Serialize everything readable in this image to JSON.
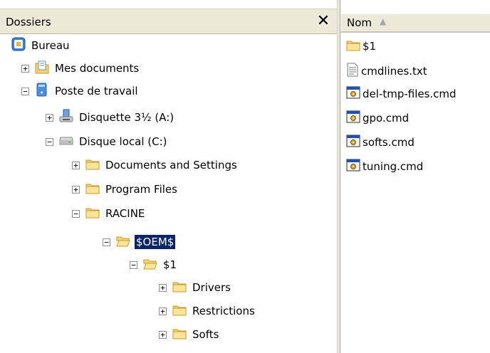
{
  "folders_pane": {
    "title": "Dossiers",
    "close_label": "✕",
    "tree": [
      {
        "label": "Bureau",
        "icon": "desktop-icon",
        "toggle": ""
      },
      {
        "label": "Mes documents",
        "icon": "my-documents-icon",
        "toggle": "+"
      },
      {
        "label": "Poste de travail",
        "icon": "my-computer-icon",
        "toggle": "−"
      },
      {
        "label": "Disquette 3½ (A:)",
        "icon": "floppy-drive-icon",
        "toggle": "+"
      },
      {
        "label": "Disque local (C:)",
        "icon": "hard-drive-icon",
        "toggle": "−"
      },
      {
        "label": "Documents and Settings",
        "icon": "folder-icon",
        "toggle": "+"
      },
      {
        "label": "Program Files",
        "icon": "folder-icon",
        "toggle": "+"
      },
      {
        "label": "RACINE",
        "icon": "folder-icon",
        "toggle": "−"
      },
      {
        "label": "$OEM$",
        "icon": "folder-open-icon",
        "toggle": "−",
        "selected": true
      },
      {
        "label": "$1",
        "icon": "folder-open-icon",
        "toggle": "−"
      },
      {
        "label": "Drivers",
        "icon": "folder-icon",
        "toggle": "+"
      },
      {
        "label": "Restrictions",
        "icon": "folder-icon",
        "toggle": "+"
      },
      {
        "label": "Softs",
        "icon": "folder-icon",
        "toggle": "+"
      }
    ]
  },
  "files_pane": {
    "column_name": "Nom",
    "sort_indicator": "▲",
    "files": [
      {
        "name": "$1",
        "icon": "folder-icon"
      },
      {
        "name": "cmdlines.txt",
        "icon": "text-file-icon"
      },
      {
        "name": "del-tmp-files.cmd",
        "icon": "cmd-file-icon"
      },
      {
        "name": "gpo.cmd",
        "icon": "cmd-file-icon"
      },
      {
        "name": "softs.cmd",
        "icon": "cmd-file-icon"
      },
      {
        "name": "tuning.cmd",
        "icon": "cmd-file-icon"
      }
    ]
  },
  "colors": {
    "pane_header": "#ece9d8",
    "selection": "#0a246a",
    "folder_yellow": "#f6d36b"
  }
}
